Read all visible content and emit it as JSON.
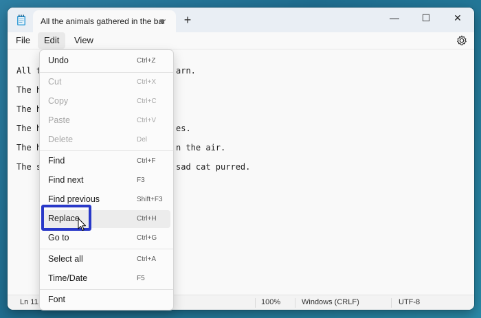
{
  "window": {
    "tab_title": "All the animals gathered in the bar",
    "new_tab_symbol": "+",
    "minimize_symbol": "—",
    "maximize_symbol": "☐",
    "close_symbol": "✕"
  },
  "menubar": {
    "file": "File",
    "edit": "Edit",
    "view": "View"
  },
  "editor": {
    "lines": [
      "All t",
      "The h",
      "The h",
      "The h",
      "The h",
      "The s"
    ],
    "line_tails": [
      "arn.",
      "",
      "",
      "es.",
      "n the air.",
      "sad cat purred."
    ]
  },
  "edit_menu": {
    "items": [
      {
        "label": "Undo",
        "shortcut": "Ctrl+Z",
        "disabled": false
      },
      {
        "label": "Cut",
        "shortcut": "Ctrl+X",
        "disabled": true
      },
      {
        "label": "Copy",
        "shortcut": "Ctrl+C",
        "disabled": true
      },
      {
        "label": "Paste",
        "shortcut": "Ctrl+V",
        "disabled": true
      },
      {
        "label": "Delete",
        "shortcut": "Del",
        "disabled": true
      },
      {
        "label": "Find",
        "shortcut": "Ctrl+F",
        "disabled": false
      },
      {
        "label": "Find next",
        "shortcut": "F3",
        "disabled": false
      },
      {
        "label": "Find previous",
        "shortcut": "Shift+F3",
        "disabled": false
      },
      {
        "label": "Replace",
        "shortcut": "Ctrl+H",
        "disabled": false
      },
      {
        "label": "Go to",
        "shortcut": "Ctrl+G",
        "disabled": false
      },
      {
        "label": "Select all",
        "shortcut": "Ctrl+A",
        "disabled": false
      },
      {
        "label": "Time/Date",
        "shortcut": "F5",
        "disabled": false
      },
      {
        "label": "Font",
        "shortcut": "",
        "disabled": false
      }
    ]
  },
  "statusbar": {
    "position": "Ln 11,",
    "zoom": "100%",
    "line_ending": "Windows (CRLF)",
    "encoding": "UTF-8"
  },
  "colors": {
    "highlight": "#2838c8",
    "background": "#1f6d8f"
  },
  "icons": [
    "notepad-icon",
    "settings-gear-icon",
    "mouse-pointer-icon"
  ]
}
